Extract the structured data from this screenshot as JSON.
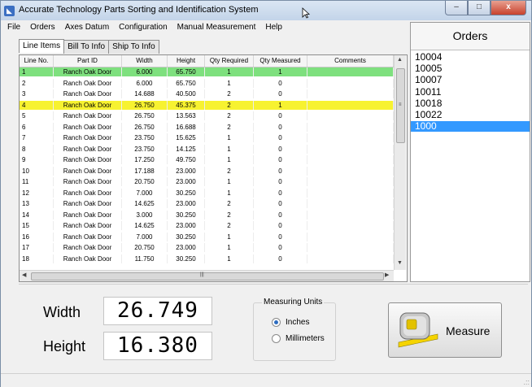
{
  "window": {
    "title": "Accurate Technology Parts Sorting and Identification System",
    "icon_name": "app-logo-icon",
    "minimize_glyph": "–",
    "maximize_glyph": "□",
    "close_glyph": "x"
  },
  "menu": [
    "File",
    "Orders",
    "Axes Datum",
    "Configuration",
    "Manual Measurement",
    "Help"
  ],
  "tabs": [
    {
      "label": "Line Items",
      "active": true
    },
    {
      "label": "Bill To Info",
      "active": false
    },
    {
      "label": "Ship To Info",
      "active": false
    }
  ],
  "grid": {
    "columns": [
      "Line No.",
      "Part ID",
      "Width",
      "Height",
      "Qty Required",
      "Qty Measured",
      "Comments"
    ],
    "rows": [
      {
        "line": "1",
        "part": "Ranch Oak Door",
        "width": "6.000",
        "height": "65.750",
        "req": "1",
        "meas": "1",
        "comment": "",
        "highlight": "green"
      },
      {
        "line": "2",
        "part": "Ranch Oak Door",
        "width": "6.000",
        "height": "65.750",
        "req": "1",
        "meas": "0",
        "comment": "",
        "highlight": ""
      },
      {
        "line": "3",
        "part": "Ranch Oak Door",
        "width": "14.688",
        "height": "40.500",
        "req": "2",
        "meas": "0",
        "comment": "",
        "highlight": ""
      },
      {
        "line": "4",
        "part": "Ranch Oak Door",
        "width": "26.750",
        "height": "45.375",
        "req": "2",
        "meas": "1",
        "comment": "",
        "highlight": "yellow"
      },
      {
        "line": "5",
        "part": "Ranch Oak Door",
        "width": "26.750",
        "height": "13.563",
        "req": "2",
        "meas": "0",
        "comment": "",
        "highlight": ""
      },
      {
        "line": "6",
        "part": "Ranch Oak Door",
        "width": "26.750",
        "height": "16.688",
        "req": "2",
        "meas": "0",
        "comment": "",
        "highlight": ""
      },
      {
        "line": "7",
        "part": "Ranch Oak Door",
        "width": "23.750",
        "height": "15.625",
        "req": "1",
        "meas": "0",
        "comment": "",
        "highlight": ""
      },
      {
        "line": "8",
        "part": "Ranch Oak Door",
        "width": "23.750",
        "height": "14.125",
        "req": "1",
        "meas": "0",
        "comment": "",
        "highlight": ""
      },
      {
        "line": "9",
        "part": "Ranch Oak Door",
        "width": "17.250",
        "height": "49.750",
        "req": "1",
        "meas": "0",
        "comment": "",
        "highlight": ""
      },
      {
        "line": "10",
        "part": "Ranch Oak Door",
        "width": "17.188",
        "height": "23.000",
        "req": "2",
        "meas": "0",
        "comment": "",
        "highlight": ""
      },
      {
        "line": "11",
        "part": "Ranch Oak Door",
        "width": "20.750",
        "height": "23.000",
        "req": "1",
        "meas": "0",
        "comment": "",
        "highlight": ""
      },
      {
        "line": "12",
        "part": "Ranch Oak Door",
        "width": "7.000",
        "height": "30.250",
        "req": "1",
        "meas": "0",
        "comment": "",
        "highlight": ""
      },
      {
        "line": "13",
        "part": "Ranch Oak Door",
        "width": "14.625",
        "height": "23.000",
        "req": "2",
        "meas": "0",
        "comment": "",
        "highlight": ""
      },
      {
        "line": "14",
        "part": "Ranch Oak Door",
        "width": "3.000",
        "height": "30.250",
        "req": "2",
        "meas": "0",
        "comment": "",
        "highlight": ""
      },
      {
        "line": "15",
        "part": "Ranch Oak Door",
        "width": "14.625",
        "height": "23.000",
        "req": "2",
        "meas": "0",
        "comment": "",
        "highlight": ""
      },
      {
        "line": "16",
        "part": "Ranch Oak Door",
        "width": "7.000",
        "height": "30.250",
        "req": "1",
        "meas": "0",
        "comment": "",
        "highlight": ""
      },
      {
        "line": "17",
        "part": "Ranch Oak Door",
        "width": "20.750",
        "height": "23.000",
        "req": "1",
        "meas": "0",
        "comment": "",
        "highlight": ""
      },
      {
        "line": "18",
        "part": "Ranch Oak Door",
        "width": "11.750",
        "height": "30.250",
        "req": "1",
        "meas": "0",
        "comment": "",
        "highlight": ""
      }
    ]
  },
  "scroll": {
    "up": "▲",
    "down": "▼",
    "left": "◀",
    "right": "▶",
    "grip": "≡",
    "hgrip": "|||"
  },
  "orders": {
    "title": "Orders",
    "items": [
      "10004",
      "10005",
      "10007",
      "10011",
      "10018",
      "10022",
      "1000"
    ],
    "selected_index": 6
  },
  "measurement": {
    "width_label": "Width",
    "width_value": "26.749",
    "height_label": "Height",
    "height_value": "16.380"
  },
  "units": {
    "title": "Measuring Units",
    "options": [
      {
        "label": "Inches",
        "selected": true
      },
      {
        "label": "Millimeters",
        "selected": false
      }
    ]
  },
  "measure_button": {
    "label": "Measure",
    "icon_name": "tape-measure-icon"
  },
  "status": {
    "grip": ".::"
  },
  "colors": {
    "green_row": "#7ee07e",
    "yellow_row": "#f7f230",
    "selected_order": "#3399ff"
  }
}
